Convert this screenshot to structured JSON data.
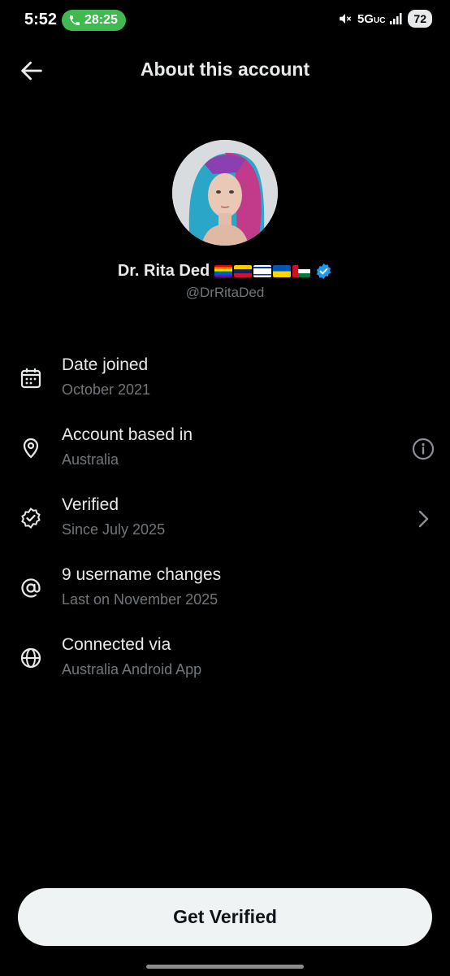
{
  "status_bar": {
    "time": "5:52",
    "call_timer": "28:25",
    "network": "5G",
    "network_suffix": "UC",
    "battery": "72"
  },
  "header": {
    "title": "About this account"
  },
  "profile": {
    "name": "Dr. Rita Ded",
    "handle": "@DrRitaDed",
    "verified": true
  },
  "info": [
    {
      "label": "Date joined",
      "value": "October 2021",
      "icon": "calendar-icon"
    },
    {
      "label": "Account based in",
      "value": "Australia",
      "icon": "location-pin-icon",
      "trailing": "info-icon"
    },
    {
      "label": "Verified",
      "value": "Since July 2025",
      "icon": "verified-badge-icon",
      "trailing": "chevron-right-icon"
    },
    {
      "label": "9 username changes",
      "value": "Last on November 2025",
      "icon": "at-sign-icon"
    },
    {
      "label": "Connected via",
      "value": "Australia Android App",
      "icon": "globe-icon"
    }
  ],
  "cta": {
    "label": "Get Verified"
  },
  "colors": {
    "background": "#000000",
    "primary_text": "#e7e9ea",
    "secondary_text": "#71767b",
    "verified_blue": "#1d9bf0",
    "call_green": "#3fb950",
    "button_bg": "#eff3f4"
  }
}
